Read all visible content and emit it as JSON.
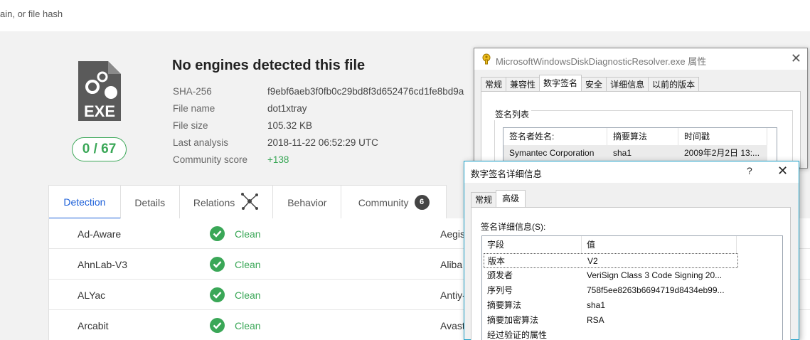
{
  "search": {
    "partial_text": "ain, or file hash"
  },
  "file": {
    "icon_label": "EXE",
    "score": "0 / 67",
    "headline": "No engines detected this file",
    "meta": [
      {
        "label": "SHA-256",
        "value": "f9ebf6aeb3f0fb0c29bd8f3d652476cd1fe8bd9a"
      },
      {
        "label": "File name",
        "value": "dot1xtray"
      },
      {
        "label": "File size",
        "value": "105.32 KB"
      },
      {
        "label": "Last analysis",
        "value": "2018-11-22 06:52:29 UTC"
      },
      {
        "label": "Community score",
        "value": "+138"
      }
    ]
  },
  "tabs": [
    {
      "label": "Detection"
    },
    {
      "label": "Details"
    },
    {
      "label": "Relations"
    },
    {
      "label": "Behavior"
    },
    {
      "label": "Community",
      "badge": "6"
    }
  ],
  "results": [
    {
      "engine": "Ad-Aware",
      "status": "Clean",
      "engine2": "Aegis"
    },
    {
      "engine": "AhnLab-V3",
      "status": "Clean",
      "engine2": "Aliba"
    },
    {
      "engine": "ALYac",
      "status": "Clean",
      "engine2": "Antiy-"
    },
    {
      "engine": "Arcabit",
      "status": "Clean",
      "engine2": "Avast"
    }
  ],
  "props_dialog": {
    "title": "MicrosoftWindowsDiskDiagnosticResolver.exe 属性",
    "tabs": [
      "常规",
      "兼容性",
      "数字签名",
      "安全",
      "详细信息",
      "以前的版本"
    ],
    "group_label": "签名列表",
    "columns": [
      "签名者姓名:",
      "摘要算法",
      "时间戳"
    ],
    "row": [
      "Symantec Corporation",
      "sha1",
      "2009年2月2日 13:..."
    ]
  },
  "sig_dialog": {
    "title": "数字签名详细信息",
    "help": "?",
    "tabs": [
      "常规",
      "高级"
    ],
    "label": "签名详细信息(S):",
    "columns": [
      "字段",
      "值"
    ],
    "rows": [
      {
        "field": "版本",
        "value": "V2"
      },
      {
        "field": "颁发者",
        "value": "VeriSign Class 3 Code Signing 20..."
      },
      {
        "field": "序列号",
        "value": "758f5ee8263b6694719d8434eb99..."
      },
      {
        "field": "摘要算法",
        "value": "sha1"
      },
      {
        "field": "摘要加密算法",
        "value": "RSA"
      },
      {
        "field": "经过验证的属性",
        "value": ""
      }
    ]
  },
  "colors": {
    "accent": "#1b5fd9",
    "clean": "#3aa757",
    "dialog_border": "#1ca0c8"
  }
}
